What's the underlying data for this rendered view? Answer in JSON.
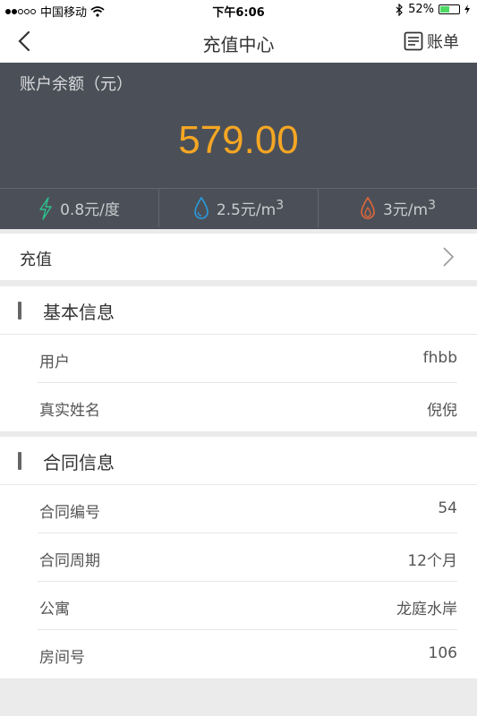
{
  "status_bar": {
    "carrier": "中国移动",
    "time": "下午6:06",
    "battery": "52%",
    "battery_level": 0.52
  },
  "navbar": {
    "title": "充值中心",
    "bill_label": "账单"
  },
  "account": {
    "label": "账户余额（元）",
    "balance": "579.00"
  },
  "rates": [
    {
      "icon": "lightning-icon",
      "value": "0.8元/度",
      "color": "#2fbf8e"
    },
    {
      "icon": "water-drop-icon",
      "value": "2.5元/m",
      "sup": "3",
      "color": "#2a9be0"
    },
    {
      "icon": "gas-flame-icon",
      "value": "3元/m",
      "sup": "3",
      "color": "#e0663a"
    }
  ],
  "charge": {
    "label": "充值"
  },
  "basic_info": {
    "title": "基本信息",
    "rows": [
      {
        "key": "用户",
        "value": "fhbb"
      },
      {
        "key": "真实姓名",
        "value": "倪倪"
      }
    ]
  },
  "contract_info": {
    "title": "合同信息",
    "rows": [
      {
        "key": "合同编号",
        "value": "54"
      },
      {
        "key": "合同周期",
        "value": "12个月"
      },
      {
        "key": "公寓",
        "value": "龙庭水岸"
      },
      {
        "key": "房间号",
        "value": "106"
      }
    ]
  },
  "colors": {
    "accent": "#f5a623",
    "header_bg": "#4b5058"
  }
}
